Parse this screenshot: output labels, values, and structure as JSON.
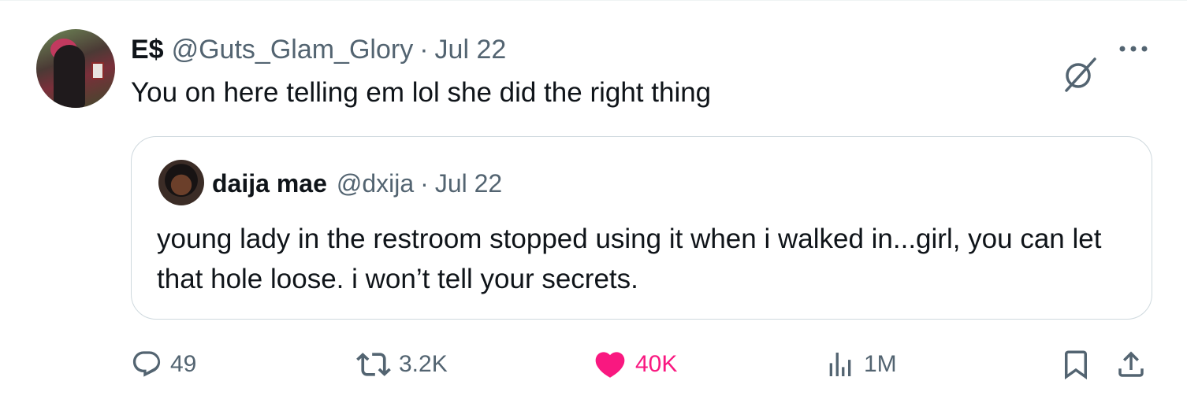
{
  "tweet": {
    "author_name": "E$",
    "author_handle": "@Guts_Glam_Glory",
    "separator": "·",
    "date": "Jul 22",
    "text": "You on here telling em lol she did the right thing"
  },
  "quoted_tweet": {
    "author_name": "daija mae",
    "author_handle": "@dxija",
    "separator": "·",
    "date": "Jul 22",
    "text": "young lady in the restroom stopped using it when i walked in...girl, you can let that hole loose. i won’t tell your secrets."
  },
  "actions": {
    "replies": "49",
    "reposts": "3.2K",
    "likes": "40K",
    "views": "1M"
  },
  "icons": {
    "reply": "reply-icon",
    "repost": "repost-icon",
    "like": "heart-icon",
    "views": "views-icon",
    "bookmark": "bookmark-icon",
    "share": "share-icon",
    "grok": "grok-icon",
    "more": "more-icon"
  },
  "colors": {
    "text": "#0f1419",
    "secondary": "#536471",
    "like": "#f91880",
    "border": "#cfd9de"
  }
}
